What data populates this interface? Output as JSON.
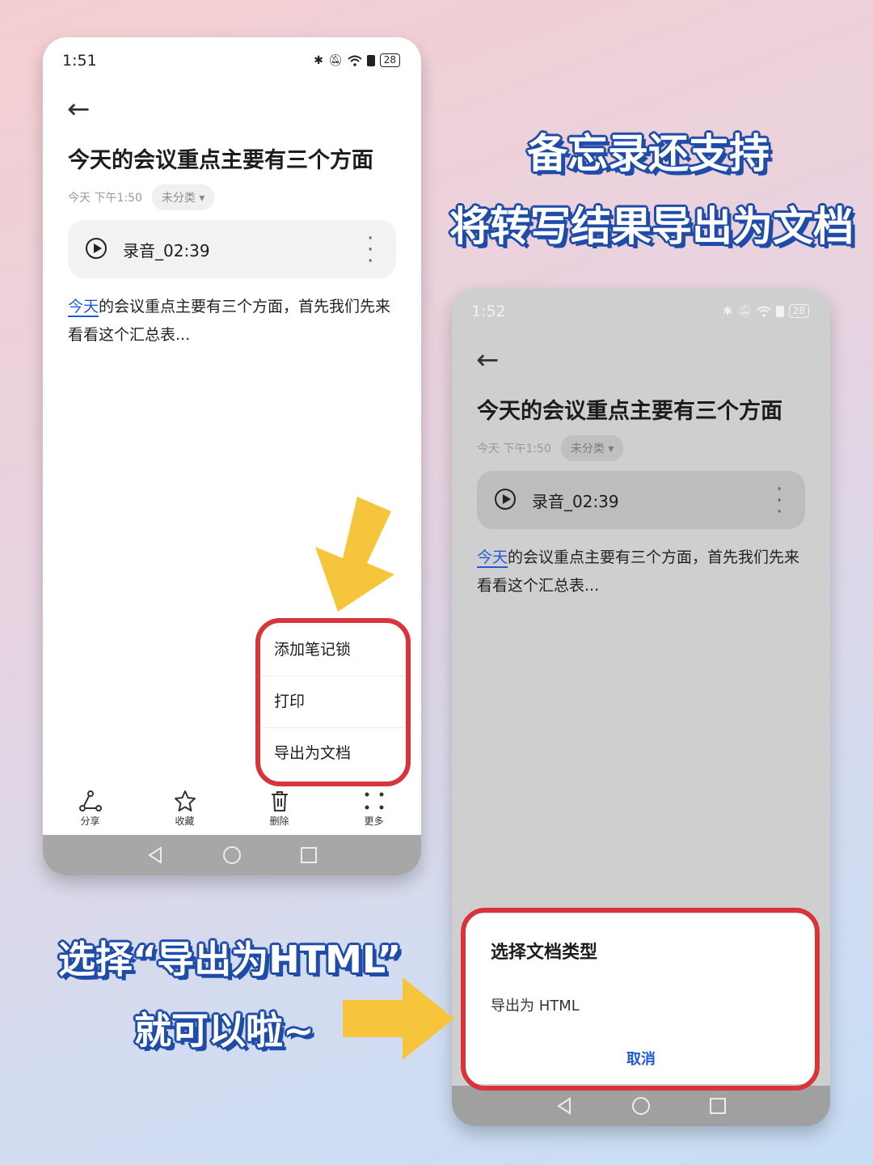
{
  "colors": {
    "accent_red": "#d7343c",
    "arrow_yellow": "#f6c53c",
    "caption_blue": "#1e4ca8",
    "link_blue": "#1d5bd8"
  },
  "captions": {
    "top_line1": "备忘录还支持",
    "top_line2": "将转写结果导出为文档",
    "bottom_line1": "选择“导出为HTML”",
    "bottom_line2": "就可以啦~"
  },
  "phone1": {
    "time": "1:51",
    "battery": "28",
    "title": "今天的会议重点主要有三个方面",
    "date": "今天 下午1:50",
    "category": "未分类",
    "recording": "录音_02:39",
    "body_highlight": "今天",
    "body_rest": "的会议重点主要有三个方面，首先我们先来看看这个汇总表...",
    "menu": [
      "添加笔记锁",
      "打印",
      "导出为文档"
    ],
    "toolbar": [
      "分享",
      "收藏",
      "删除",
      "更多"
    ]
  },
  "phone2": {
    "time": "1:52",
    "battery": "28",
    "title": "今天的会议重点主要有三个方面",
    "date": "今天 下午1:50",
    "category": "未分类",
    "recording": "录音_02:39",
    "body_highlight": "今天",
    "body_rest": "的会议重点主要有三个方面，首先我们先来看看这个汇总表...",
    "sheet": {
      "title": "选择文档类型",
      "option": "导出为 HTML",
      "cancel": "取消"
    }
  }
}
